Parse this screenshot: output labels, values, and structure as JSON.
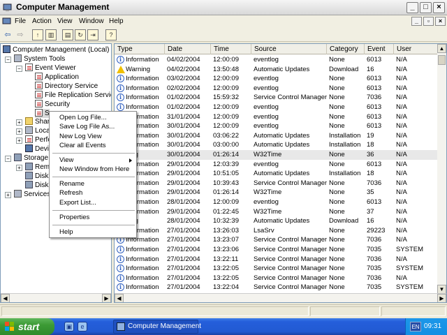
{
  "window": {
    "title": "Computer Management"
  },
  "menubar": {
    "items": [
      "File",
      "Action",
      "View",
      "Window",
      "Help"
    ]
  },
  "tree": {
    "items": [
      {
        "label": "Computer Management (Local)",
        "icon": "computer-icon",
        "level": 0
      },
      {
        "label": "System Tools",
        "icon": "tools-icon",
        "level": 1
      },
      {
        "label": "Event Viewer",
        "icon": "event-viewer-icon",
        "level": 2
      },
      {
        "label": "Application",
        "icon": "log-icon",
        "level": 3
      },
      {
        "label": "Directory Service",
        "icon": "log-icon",
        "level": 3
      },
      {
        "label": "File Replication Service",
        "icon": "log-icon",
        "level": 3
      },
      {
        "label": "Security",
        "icon": "log-icon",
        "level": 3
      },
      {
        "label": "S",
        "icon": "log-icon",
        "level": 3
      },
      {
        "label": "Share",
        "icon": "folder-icon",
        "level": 2
      },
      {
        "label": "Local",
        "icon": "users-icon",
        "level": 2
      },
      {
        "label": "Perfo",
        "icon": "performance-icon",
        "level": 2
      },
      {
        "label": "Devic",
        "icon": "device-icon",
        "level": 2
      },
      {
        "label": "Storage",
        "icon": "storage-icon",
        "level": 1
      },
      {
        "label": "Remo",
        "icon": "removable-icon",
        "level": 2
      },
      {
        "label": "Disk D",
        "icon": "disk-icon",
        "level": 2
      },
      {
        "label": "Disk M",
        "icon": "disk-icon",
        "level": 2
      },
      {
        "label": "Services a",
        "icon": "services-icon",
        "level": 1
      }
    ]
  },
  "list": {
    "columns": [
      "Type",
      "Date",
      "Time",
      "Source",
      "Category",
      "Event",
      "User"
    ],
    "rows": [
      {
        "type": "Information",
        "date": "04/02/2004",
        "time": "12:00:09",
        "source": "eventlog",
        "category": "None",
        "event": "6013",
        "user": "N/A"
      },
      {
        "type": "Warning",
        "date": "04/02/2004",
        "time": "13:50:48",
        "source": "Automatic Updates",
        "category": "Download",
        "event": "16",
        "user": "N/A"
      },
      {
        "type": "Information",
        "date": "03/02/2004",
        "time": "12:00:09",
        "source": "eventlog",
        "category": "None",
        "event": "6013",
        "user": "N/A"
      },
      {
        "type": "Information",
        "date": "02/02/2004",
        "time": "12:00:09",
        "source": "eventlog",
        "category": "None",
        "event": "6013",
        "user": "N/A"
      },
      {
        "type": "Information",
        "date": "01/02/2004",
        "time": "15:59:32",
        "source": "Service Control Manager",
        "category": "None",
        "event": "7036",
        "user": "N/A"
      },
      {
        "type": "Information",
        "date": "01/02/2004",
        "time": "12:00:09",
        "source": "eventlog",
        "category": "None",
        "event": "6013",
        "user": "N/A"
      },
      {
        "type": "Information",
        "date": "31/01/2004",
        "time": "12:00:09",
        "source": "eventlog",
        "category": "None",
        "event": "6013",
        "user": "N/A"
      },
      {
        "type": "Information",
        "date": "30/01/2004",
        "time": "12:00:09",
        "source": "eventlog",
        "category": "None",
        "event": "6013",
        "user": "N/A"
      },
      {
        "type": "Information",
        "date": "30/01/2004",
        "time": "03:06:22",
        "source": "Automatic Updates",
        "category": "Installation",
        "event": "19",
        "user": "N/A"
      },
      {
        "type": "Information",
        "date": "30/01/2004",
        "time": "03:00:00",
        "source": "Automatic Updates",
        "category": "Installation",
        "event": "18",
        "user": "N/A"
      },
      {
        "type": "ning",
        "date": "30/01/2004",
        "time": "01:26:14",
        "source": "W32Time",
        "category": "None",
        "event": "36",
        "user": "N/A"
      },
      {
        "type": "Information",
        "date": "29/01/2004",
        "time": "12:03:39",
        "source": "eventlog",
        "category": "None",
        "event": "6013",
        "user": "N/A"
      },
      {
        "type": "Information",
        "date": "29/01/2004",
        "time": "10:51:05",
        "source": "Automatic Updates",
        "category": "Installation",
        "event": "18",
        "user": "N/A"
      },
      {
        "type": "Information",
        "date": "29/01/2004",
        "time": "10:39:43",
        "source": "Service Control Manager",
        "category": "None",
        "event": "7036",
        "user": "N/A"
      },
      {
        "type": "Information",
        "date": "29/01/2004",
        "time": "01:26:14",
        "source": "W32Time",
        "category": "None",
        "event": "35",
        "user": "N/A"
      },
      {
        "type": "Information",
        "date": "28/01/2004",
        "time": "12:00:09",
        "source": "eventlog",
        "category": "None",
        "event": "6013",
        "user": "N/A"
      },
      {
        "type": "Information",
        "date": "29/01/2004",
        "time": "01:22:45",
        "source": "W32Time",
        "category": "None",
        "event": "37",
        "user": "N/A"
      },
      {
        "type": "ning",
        "date": "28/01/2004",
        "time": "10:32:39",
        "source": "Automatic Updates",
        "category": "Download",
        "event": "16",
        "user": "N/A"
      },
      {
        "type": "Information",
        "date": "27/01/2004",
        "time": "13:26:03",
        "source": "LsaSrv",
        "category": "None",
        "event": "29223",
        "user": "N/A"
      },
      {
        "type": "Information",
        "date": "27/01/2004",
        "time": "13:23:07",
        "source": "Service Control Manager",
        "category": "None",
        "event": "7036",
        "user": "N/A"
      },
      {
        "type": "Information",
        "date": "27/01/2004",
        "time": "13:23:06",
        "source": "Service Control Manager",
        "category": "None",
        "event": "7035",
        "user": "SYSTEM"
      },
      {
        "type": "Information",
        "date": "27/01/2004",
        "time": "13:22:11",
        "source": "Service Control Manager",
        "category": "None",
        "event": "7036",
        "user": "N/A"
      },
      {
        "type": "Information",
        "date": "27/01/2004",
        "time": "13:22:05",
        "source": "Service Control Manager",
        "category": "None",
        "event": "7035",
        "user": "SYSTEM"
      },
      {
        "type": "Information",
        "date": "27/01/2004",
        "time": "13:22:05",
        "source": "Service Control Manager",
        "category": "None",
        "event": "7036",
        "user": "N/A"
      },
      {
        "type": "Information",
        "date": "27/01/2004",
        "time": "13:22:04",
        "source": "Service Control Manager",
        "category": "None",
        "event": "7035",
        "user": "SYSTEM"
      }
    ]
  },
  "context_menu": {
    "items": [
      "Open Log File...",
      "Save Log File As...",
      "New Log View",
      "Clear all Events",
      "View",
      "New Window from Here",
      "Rename",
      "Refresh",
      "Export List...",
      "Properties",
      "Help"
    ]
  },
  "taskbar": {
    "start_label": "start",
    "task_label": "Computer Management",
    "lang": "EN",
    "clock": "09:31"
  }
}
